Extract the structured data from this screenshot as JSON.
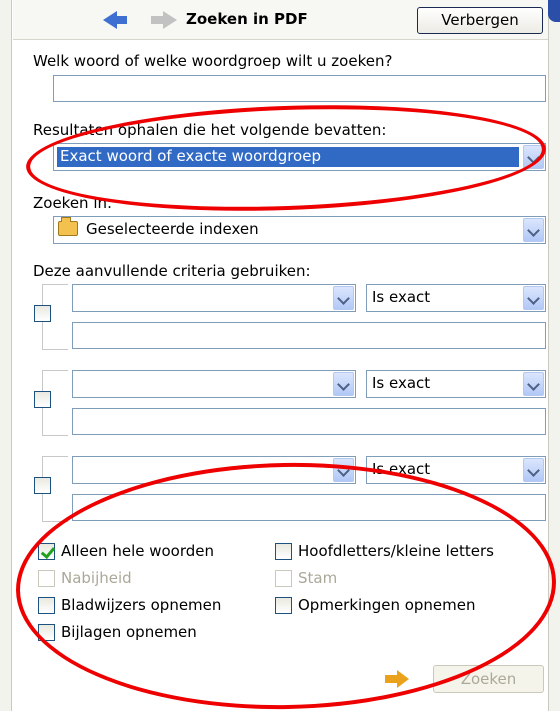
{
  "panel": {
    "title": "Zoeken in PDF",
    "hide_button": "Verbergen"
  },
  "query": {
    "label": "Welk woord of welke woordgroep wilt u zoeken?",
    "value": ""
  },
  "results": {
    "label": "Resultaten ophalen die het volgende bevatten:",
    "selected": "Exact woord of exacte woordgroep"
  },
  "search_in": {
    "label": "Zoeken in:",
    "selected": "Geselecteerde indexen",
    "icon": "folder-icon"
  },
  "criteria": {
    "label": "Deze aanvullende criteria gebruiken:",
    "rows": [
      {
        "field": "",
        "operator": "Is exact",
        "value": ""
      },
      {
        "field": "",
        "operator": "Is exact",
        "value": ""
      },
      {
        "field": "",
        "operator": "Is exact",
        "value": ""
      }
    ]
  },
  "options": {
    "whole_words": {
      "label": "Alleen hele woorden",
      "checked": true,
      "enabled": true
    },
    "case_sensitive": {
      "label": "Hoofdletters/kleine letters",
      "checked": false,
      "enabled": true
    },
    "proximity": {
      "label": "Nabijheid",
      "checked": false,
      "enabled": false
    },
    "stemming": {
      "label": "Stam",
      "checked": false,
      "enabled": false
    },
    "bookmarks": {
      "label": "Bladwijzers opnemen",
      "checked": false,
      "enabled": true
    },
    "comments": {
      "label": "Opmerkingen opnemen",
      "checked": false,
      "enabled": true
    },
    "attachments": {
      "label": "Bijlagen opnemen",
      "checked": false,
      "enabled": true
    }
  },
  "search_button": {
    "label": "Zoeken",
    "enabled": false
  },
  "colors": {
    "selection": "#316ac5",
    "annotation": "#ee0000",
    "checkmark": "#21a121",
    "back_arrow": "#3f6fd0",
    "search_arrow": "#e9a21a"
  }
}
